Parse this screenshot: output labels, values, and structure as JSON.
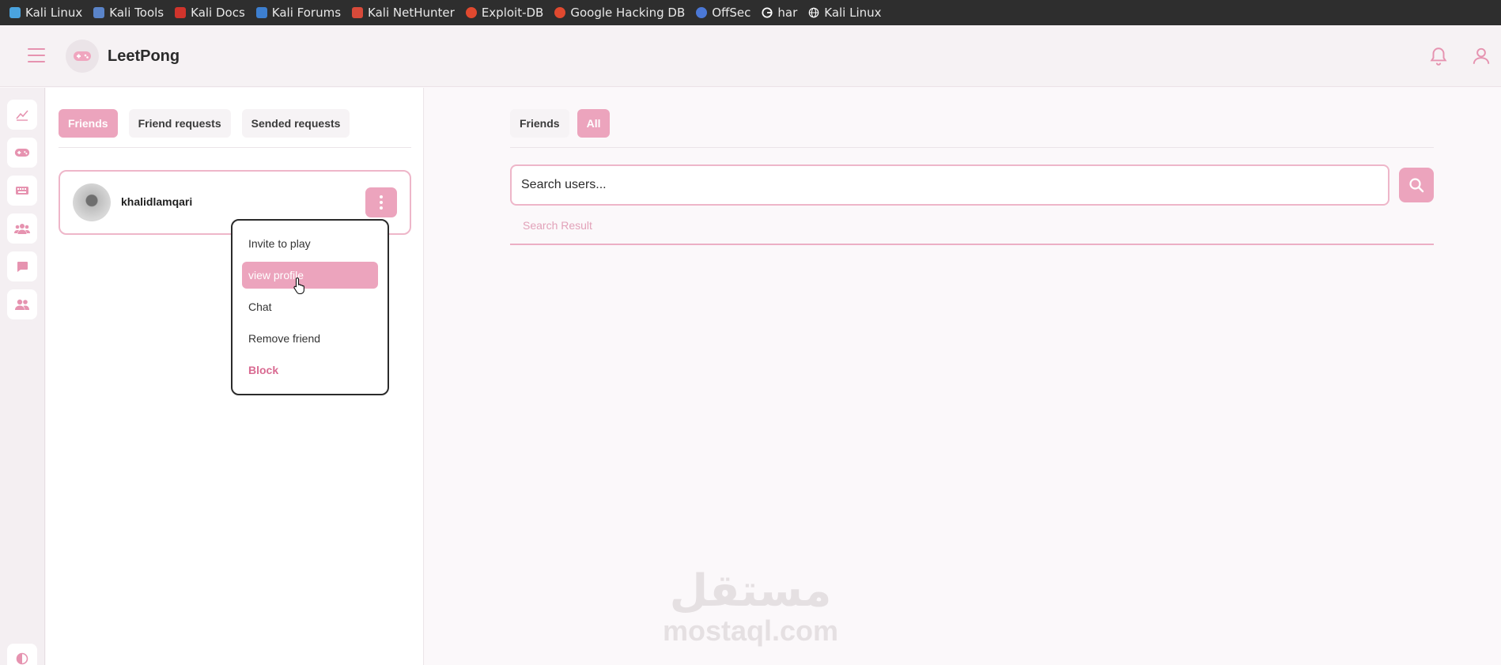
{
  "bookmarks": [
    {
      "label": "Kali Linux",
      "icon": "kali-dragon-icon",
      "color": "#4aa3df"
    },
    {
      "label": "Kali Tools",
      "icon": "kali-tools-icon",
      "color": "#5a84c9"
    },
    {
      "label": "Kali Docs",
      "icon": "kali-docs-icon",
      "color": "#d0342c"
    },
    {
      "label": "Kali Forums",
      "icon": "kali-forums-icon",
      "color": "#3d7fd0"
    },
    {
      "label": "Kali NetHunter",
      "icon": "nethunter-icon",
      "color": "#d84a3a"
    },
    {
      "label": "Exploit-DB",
      "icon": "exploit-db-icon",
      "color": "#e0492f"
    },
    {
      "label": "Google Hacking DB",
      "icon": "ghdb-icon",
      "color": "#e0492f"
    },
    {
      "label": "OffSec",
      "icon": "offsec-icon",
      "color": "#4b78d6"
    },
    {
      "label": "har",
      "icon": "google-icon",
      "color": "#ffffff"
    },
    {
      "label": "Kali Linux",
      "icon": "globe-icon",
      "color": "#ffffff"
    }
  ],
  "header": {
    "brand": "LeetPong",
    "logo_icon": "gamepad-logo-icon"
  },
  "rail": {
    "items": [
      {
        "icon": "chart-icon"
      },
      {
        "icon": "gamepad-icon"
      },
      {
        "icon": "keyboard-icon"
      },
      {
        "icon": "group-icon"
      },
      {
        "icon": "chat-icon"
      },
      {
        "icon": "friends-icon"
      }
    ],
    "theme_icon": "contrast-icon"
  },
  "friends_panel": {
    "tabs": [
      {
        "label": "Friends",
        "active": true
      },
      {
        "label": "Friend requests",
        "active": false
      },
      {
        "label": "Sended requests",
        "active": false
      }
    ],
    "friend": {
      "name": "khalidlamqari"
    },
    "menu": {
      "items": [
        {
          "label": "Invite to play"
        },
        {
          "label": "view profile",
          "hovered": true
        },
        {
          "label": "Chat"
        },
        {
          "label": "Remove friend"
        },
        {
          "label": "Block",
          "danger": true
        }
      ]
    }
  },
  "search_panel": {
    "tabs": [
      {
        "label": "Friends",
        "active": false
      },
      {
        "label": "All",
        "active": true
      }
    ],
    "search_placeholder": "Search users...",
    "result_label": "Search Result"
  },
  "watermark": {
    "arabic": "مستقل",
    "latin": "mostaql.com"
  },
  "colors": {
    "accent": "#eca4bd",
    "accent_border": "#eeb6c9",
    "danger": "#d96b92"
  }
}
